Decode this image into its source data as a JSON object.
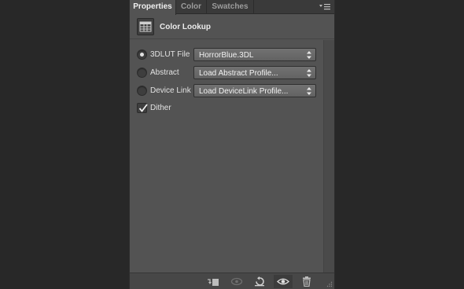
{
  "tabs": [
    {
      "label": "Properties",
      "active": true
    },
    {
      "label": "Color",
      "active": false
    },
    {
      "label": "Swatches",
      "active": false
    }
  ],
  "header": {
    "title": "Color Lookup",
    "icon": "color-lookup-table-icon"
  },
  "options": [
    {
      "label": "3DLUT File",
      "selected": true,
      "value": "HorrorBlue.3DL"
    },
    {
      "label": "Abstract",
      "selected": false,
      "value": "Load Abstract Profile..."
    },
    {
      "label": "Device Link",
      "selected": false,
      "value": "Load DeviceLink Profile..."
    }
  ],
  "dither": {
    "label": "Dither",
    "checked": true
  },
  "footer": {
    "buttons": [
      "clip-to-layer-icon",
      "view-previous-state-icon",
      "reset-icon",
      "visibility-eye-icon",
      "trash-icon"
    ]
  },
  "colors": {
    "panel": "#535353",
    "tabbar": "#3a3a3a",
    "background": "#282828"
  }
}
